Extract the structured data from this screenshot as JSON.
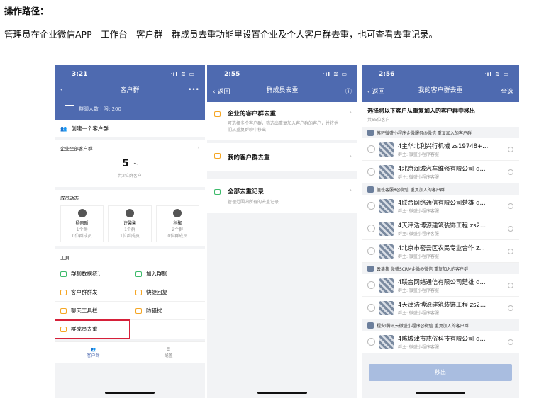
{
  "header": "操作路径：",
  "path": "管理员在企业微信APP - 工作台 - 客户群 - 群成员去重功能里设置企业及个人客户群去重，也可查看去重记录。",
  "status_icons": "ᐧıl ≋ ▭",
  "p1": {
    "time": "3:21",
    "title": "客户群",
    "more": "•••",
    "limit": "群聊人数上限: 200",
    "create": "创建一个客户群",
    "all": "企业全部客户群",
    "count": "5",
    "count_unit": "个",
    "count_sub": "共2位群客户",
    "members_title": "成员动态",
    "members": [
      {
        "name": "杨雨昕",
        "l1": "1个群",
        "l2": "0位群成员"
      },
      {
        "name": "许馨馨",
        "l1": "1个群",
        "l2": "1位群成员"
      },
      {
        "name": "科聚",
        "l1": "2个群",
        "l2": "0位群成员"
      }
    ],
    "tools_title": "工具",
    "tools": [
      "群聊数据统计",
      "加入群聊",
      "客户群群发",
      "快捷回复",
      "聊天工具栏",
      "防骚扰",
      "群成员去重"
    ],
    "tab1": "客户群",
    "tab2": "配置"
  },
  "p2": {
    "time": "2:55",
    "back": "返回",
    "title": "群成员去重",
    "items": [
      {
        "t": "企业的客户群去重",
        "d": "可选择多个客户群，筛选出重复加入客户群的客户，并将他们从重复群聊中移出"
      },
      {
        "t": "我的客户群去重",
        "d": ""
      },
      {
        "t": "全部去重记录",
        "d": "管理范围内所有的去重记录"
      }
    ]
  },
  "p3": {
    "time": "2:56",
    "back": "返回",
    "title": "我的客户群去重",
    "selall": "全选",
    "head": "选择将以下客户从重复加入的客户群中移出",
    "sub": "共65位客户",
    "groups": [
      {
        "who": "苏轩微盛小程序企微服务@微信 重复加入的客户群",
        "rows": [
          "4主华北利兴行机械 zs19748+...",
          "4北京润城汽车维修有限公司 d..."
        ]
      },
      {
        "who": "值班客服8@微信 重复加入的客户群",
        "rows": [
          "4联合网络通信有限公司楚雄 d...",
          "4天津浩博源建筑装饰工程 zs2...",
          "4北京市密云区农民专业合作 z..."
        ]
      },
      {
        "who": "云集集 微盛SCRM企微@微信 重复加入的客户群",
        "rows": [
          "4联合网络通信有限公司楚雄 d...",
          "4天津浩博源建筑装饰工程 zs2..."
        ]
      },
      {
        "who": "程安I腾讯云微盛小程序@微信 重复加入的客户群",
        "rows": [
          "4陈城津市戒俗科技有限公司 d..."
        ]
      }
    ],
    "owner": "群主: 微盛小程序客服",
    "button": "移出"
  }
}
